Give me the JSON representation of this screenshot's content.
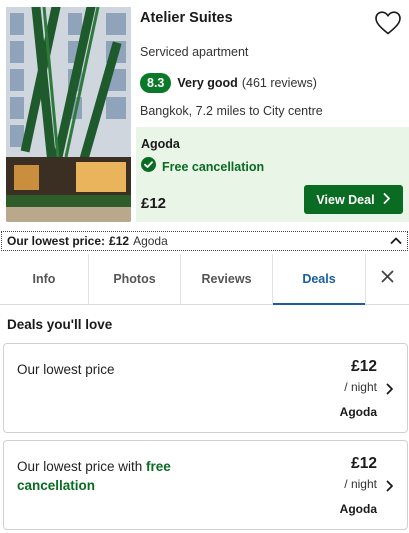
{
  "hotel": {
    "name": "Atelier Suites",
    "type": "Serviced apartment",
    "rating_score": "8.3",
    "rating_label": "Very good",
    "reviews": "(461 reviews)",
    "location": "Bangkok, 7.2 miles to City centre",
    "favorite_icon": "heart-outline-icon"
  },
  "offer": {
    "provider": "Agoda",
    "cancellation": "Free cancellation",
    "price": "£12",
    "cta_label": "View Deal"
  },
  "lowest_price_strip": {
    "label": "Our lowest price:",
    "price": "£12",
    "provider": "Agoda"
  },
  "tabs": [
    {
      "label": "Info",
      "active": false
    },
    {
      "label": "Photos",
      "active": false
    },
    {
      "label": "Reviews",
      "active": false
    },
    {
      "label": "Deals",
      "active": true
    }
  ],
  "deals": {
    "heading": "Deals you'll love",
    "items": [
      {
        "title": "Our lowest price",
        "title_highlight": "",
        "price": "£12",
        "per": "/ night",
        "provider": "Agoda"
      },
      {
        "title": "Our lowest price with ",
        "title_highlight": "free cancellation",
        "price": "£12",
        "per": "/ night",
        "provider": "Agoda"
      }
    ]
  },
  "colors": {
    "rating_green": "#0a7a2a",
    "cta_green": "#0a6b22",
    "panel_green": "#e9f5e7",
    "active_tab_blue": "#1a5ea0"
  }
}
